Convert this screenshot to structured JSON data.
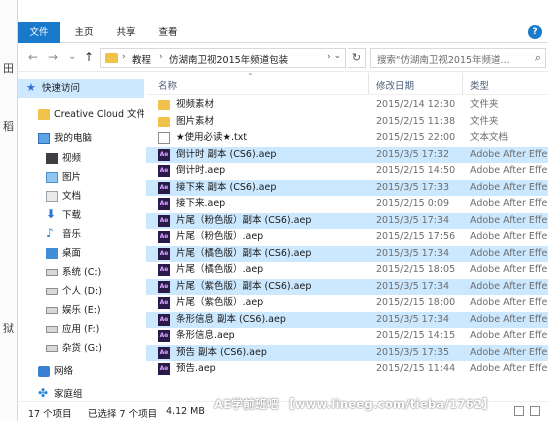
{
  "ribbon": {
    "tabs": [
      "文件",
      "主页",
      "共享",
      "查看"
    ],
    "help": "?"
  },
  "nav": {
    "back": "←",
    "forward": "→",
    "recent": "⌄",
    "up": "↑",
    "breadcrumbs": [
      "教程",
      "仿湖南卫视2015年频道包装"
    ],
    "search_placeholder": "搜索\"仿湖南卫视2015年频道...",
    "refresh": "↻",
    "search_icon": "⌕"
  },
  "sidebar": {
    "items": [
      {
        "label": "快速访问",
        "icon": "star-icon"
      },
      {
        "label": "Creative Cloud 文件",
        "icon": "folder-icon"
      },
      {
        "label": "我的电脑",
        "icon": "pc-icon"
      },
      {
        "label": "视频",
        "icon": "video-icon"
      },
      {
        "label": "图片",
        "icon": "image-icon"
      },
      {
        "label": "文档",
        "icon": "document-icon"
      },
      {
        "label": "下载",
        "icon": "download-icon"
      },
      {
        "label": "音乐",
        "icon": "music-icon"
      },
      {
        "label": "桌面",
        "icon": "desktop-icon"
      },
      {
        "label": "系统 (C:)",
        "icon": "drive-icon"
      },
      {
        "label": "个人 (D:)",
        "icon": "drive-icon"
      },
      {
        "label": "娱乐 (E:)",
        "icon": "drive-icon"
      },
      {
        "label": "应用 (F:)",
        "icon": "drive-icon"
      },
      {
        "label": "杂货 (G:)",
        "icon": "drive-icon"
      },
      {
        "label": "网络",
        "icon": "network-icon"
      },
      {
        "label": "家庭组",
        "icon": "homegroup-icon"
      }
    ]
  },
  "columns": {
    "name": "名称",
    "date": "修改日期",
    "type": "类型"
  },
  "files": [
    {
      "name": "视频素材",
      "date": "2015/2/14 12:30",
      "type": "文件夹",
      "kind": "folder",
      "selected": false
    },
    {
      "name": "图片素材",
      "date": "2015/2/15 11:38",
      "type": "文件夹",
      "kind": "folder",
      "selected": false
    },
    {
      "name": "★使用必读★.txt",
      "date": "2015/2/15 22:00",
      "type": "文本文档",
      "kind": "txt",
      "selected": false
    },
    {
      "name": "倒计时 副本 (CS6).aep",
      "date": "2015/3/5 17:32",
      "type": "Adobe After Effe...",
      "kind": "ae",
      "selected": true
    },
    {
      "name": "倒计时.aep",
      "date": "2015/2/15 14:50",
      "type": "Adobe After Effe...",
      "kind": "ae",
      "selected": false
    },
    {
      "name": "接下来 副本 (CS6).aep",
      "date": "2015/3/5 17:33",
      "type": "Adobe After Effe...",
      "kind": "ae",
      "selected": true
    },
    {
      "name": "接下来.aep",
      "date": "2015/2/15 0:09",
      "type": "Adobe After Effe...",
      "kind": "ae",
      "selected": false
    },
    {
      "name": "片尾（粉色版）副本 (CS6).aep",
      "date": "2015/3/5 17:34",
      "type": "Adobe After Effe...",
      "kind": "ae",
      "selected": true
    },
    {
      "name": "片尾（粉色版）.aep",
      "date": "2015/2/15 17:56",
      "type": "Adobe After Effe...",
      "kind": "ae",
      "selected": false
    },
    {
      "name": "片尾（橘色版）副本 (CS6).aep",
      "date": "2015/3/5 17:34",
      "type": "Adobe After Effe...",
      "kind": "ae",
      "selected": true
    },
    {
      "name": "片尾（橘色版）.aep",
      "date": "2015/2/15 18:05",
      "type": "Adobe After Effe...",
      "kind": "ae",
      "selected": false
    },
    {
      "name": "片尾（紫色版）副本 (CS6).aep",
      "date": "2015/3/5 17:34",
      "type": "Adobe After Effe...",
      "kind": "ae",
      "selected": true
    },
    {
      "name": "片尾（紫色版）.aep",
      "date": "2015/2/15 18:00",
      "type": "Adobe After Effe...",
      "kind": "ae",
      "selected": false
    },
    {
      "name": "条形信息 副本 (CS6).aep",
      "date": "2015/3/5 17:34",
      "type": "Adobe After Effe...",
      "kind": "ae",
      "selected": true
    },
    {
      "name": "条形信息.aep",
      "date": "2015/2/15 14:15",
      "type": "Adobe After Effe...",
      "kind": "ae",
      "selected": false
    },
    {
      "name": "预告 副本 (CS6).aep",
      "date": "2015/3/5 17:35",
      "type": "Adobe After Effe...",
      "kind": "ae",
      "selected": true
    },
    {
      "name": "预告.aep",
      "date": "2015/2/15 11:44",
      "type": "Adobe After Effe...",
      "kind": "ae",
      "selected": false
    }
  ],
  "status": {
    "count": "17 个项目",
    "selected": "已选择 7 个项目",
    "size": "4.12 MB"
  },
  "watermark": "AE学前班吧 【www.lineeg.com/tieba/1762】",
  "colors": {
    "accent": "#1979ca",
    "selection": "#cce8ff"
  }
}
